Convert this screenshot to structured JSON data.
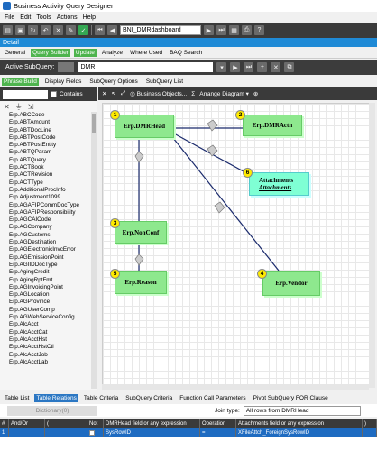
{
  "window": {
    "title": "Business Activity Query Designer"
  },
  "menu": [
    "File",
    "Edit",
    "Tools",
    "Actions",
    "Help"
  ],
  "toolbar": {
    "query_name": "BNI_DMRdashboard"
  },
  "detail_bar": "Detail",
  "main_tabs": [
    "General",
    "Query Builder",
    "Update",
    "Analyze",
    "Where Used",
    "BAQ Search"
  ],
  "subquery": {
    "label": "Active SubQuery:",
    "value": "DMR"
  },
  "builder_tabs": [
    "Phrase Build",
    "Display Fields",
    "SubQuery Options",
    "SubQuery List"
  ],
  "table_search": {
    "contains_label": "Contains"
  },
  "table_list": [
    "Erp.ABCCode",
    "Erp.ABTAmount",
    "Erp.ABTDocLine",
    "Erp.ABTPostCode",
    "Erp.ABTPostEntity",
    "Erp.ABTQParam",
    "Erp.ABTQuery",
    "Erp.ACTBook",
    "Erp.ACTRevision",
    "Erp.ACTType",
    "Erp.AdditionalProcInfo",
    "Erp.Adjustment1099",
    "Erp.AGAFIPCommDocType",
    "Erp.AGAFIPResponsibility",
    "Erp.AGCAICode",
    "Erp.AGCompany",
    "Erp.AGCustoms",
    "Erp.AGDestination",
    "Erp.AGElectronicInvcError",
    "Erp.AGEmissionPoint",
    "Erp.AGIIDDocType",
    "Erp.AgingCredit",
    "Erp.AgingRptFmt",
    "Erp.AGInvoicingPoint",
    "Erp.AGLocation",
    "Erp.AGProvince",
    "Erp.AGUserComp",
    "Erp.AGWebServiceConfig",
    "Erp.AlcAcct",
    "Erp.AlcAcctCat",
    "Erp.AlcAcctHst",
    "Erp.AlcAcctHstCtl",
    "Erp.AlcAcctJob",
    "Erp.AlcAcctLab"
  ],
  "diagram_toolbar": {
    "business_objects": "Business Objects...",
    "arrange": "Arrange Diagram"
  },
  "nodes": [
    {
      "num": "1",
      "name": "Erp.DMRHead"
    },
    {
      "num": "2",
      "name": "Erp.DMRActn"
    },
    {
      "num": "6",
      "name": "Attachments",
      "sub": "Attachments"
    },
    {
      "num": "3",
      "name": "Erp.NonConf"
    },
    {
      "num": "5",
      "name": "Erp.Reason"
    },
    {
      "num": "4",
      "name": "Erp.Vendor"
    }
  ],
  "bottom_tabs": [
    "Table List",
    "Table Relations",
    "Table Criteria",
    "SubQuery Criteria",
    "Function Call Parameters",
    "Pivot SubQuery FOR Clause"
  ],
  "relations": {
    "dictionary_button": "Dictionary(0)",
    "join_type_label": "Join type:",
    "join_type_value": "All rows from DMRHead",
    "columns": [
      "#",
      "And/Or",
      "(",
      "Not",
      "DMRHead field or any expression",
      "Operation",
      "Attachments field or any expression",
      ")"
    ],
    "rows": [
      {
        "num": "1",
        "and_or": "",
        "paren": "",
        "not": "",
        "left": "SysRowID",
        "op": "=",
        "right": "XFileAttch_ForeignSysRowID",
        "close": ""
      }
    ]
  }
}
